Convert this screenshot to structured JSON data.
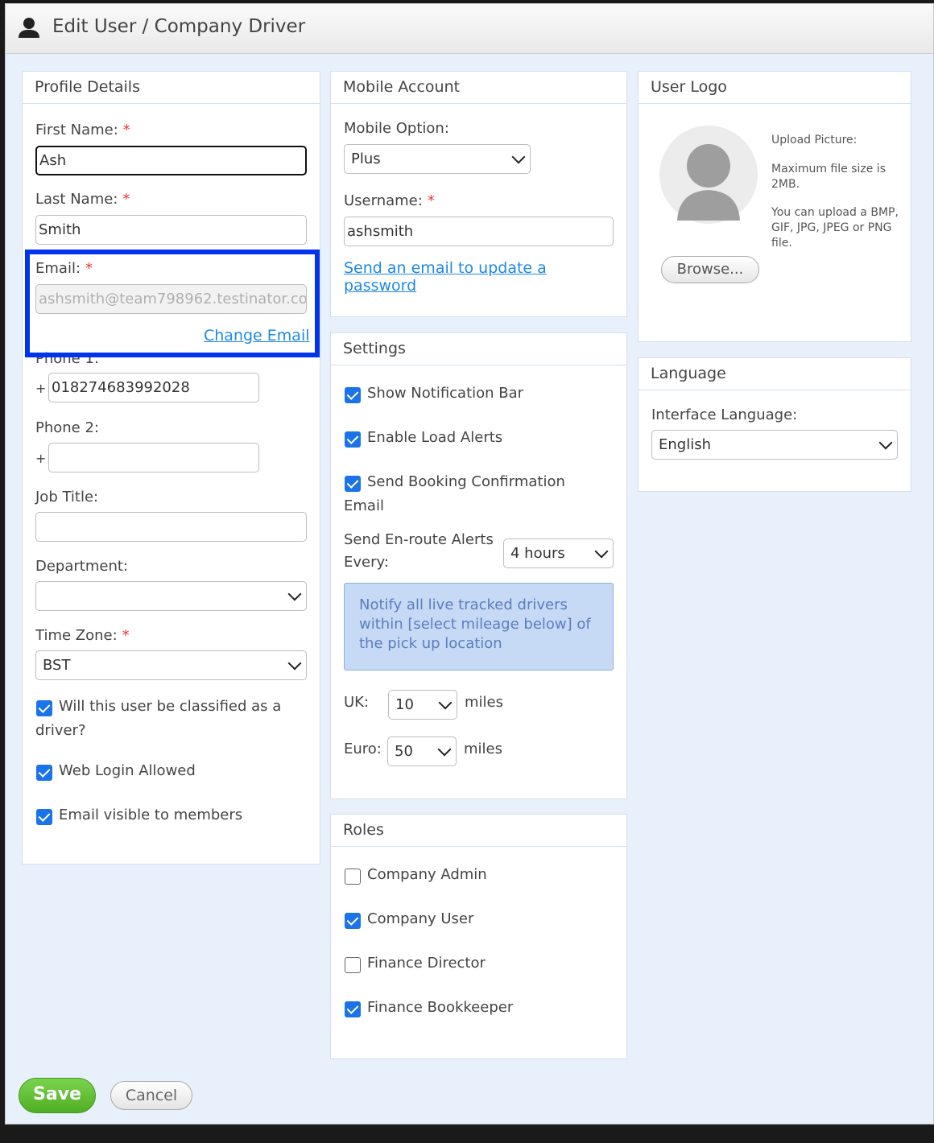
{
  "dialog": {
    "title": "Edit User / Company Driver"
  },
  "profile": {
    "heading": "Profile Details",
    "first_name_label": "First Name:",
    "first_name_value": "Ash",
    "last_name_label": "Last Name:",
    "last_name_value": "Smith",
    "email_label": "Email:",
    "email_value": "ashsmith@team798962.testinator.co",
    "change_email": "Change Email",
    "phone1_label": "Phone 1:",
    "phone1_prefix": "+",
    "phone1_value": "018274683992028",
    "phone2_label": "Phone 2:",
    "phone2_prefix": "+",
    "phone2_value": "",
    "job_title_label": "Job Title:",
    "job_title_value": "",
    "department_label": "Department:",
    "department_value": "",
    "timezone_label": "Time Zone:",
    "timezone_value": "BST",
    "required_marker": "*",
    "driver_line1": "Will this user be classified as a",
    "driver_line2": "driver?",
    "web_login": "Web Login Allowed",
    "email_visible": "Email visible to members"
  },
  "mobile": {
    "heading": "Mobile Account",
    "option_label": "Mobile Option:",
    "option_value": "Plus",
    "username_label": "Username:",
    "username_value": "ashsmith",
    "reset_line1": "Send an email to update a",
    "reset_line2": "password"
  },
  "settings": {
    "heading": "Settings",
    "show_notification": "Show Notification Bar",
    "enable_load_alerts": "Enable Load Alerts",
    "booking_line1": "Send Booking Confirmation",
    "booking_line2": "Email",
    "enroute_line1": "Send En-route Alerts",
    "enroute_line2": "Every:",
    "enroute_value": "4 hours",
    "info_text": "Notify all live tracked drivers within [select mileage below] of the pick up location",
    "uk_label": "UK:",
    "uk_value": "10",
    "euro_label": "Euro:",
    "euro_value": "50",
    "miles": "miles"
  },
  "roles": {
    "heading": "Roles",
    "items": [
      {
        "label": "Company Admin",
        "checked": false
      },
      {
        "label": "Company User",
        "checked": true
      },
      {
        "label": "Finance Director",
        "checked": false
      },
      {
        "label": "Finance Bookkeeper",
        "checked": true
      }
    ]
  },
  "logo": {
    "heading": "User Logo",
    "upload_label": "Upload Picture:",
    "max_size": "Maximum file size is 2MB.",
    "formats": "You can upload a BMP, GIF, JPG, JPEG or PNG file.",
    "browse": "Browse..."
  },
  "language": {
    "heading": "Language",
    "interface_label": "Interface Language:",
    "interface_value": "English"
  },
  "actions": {
    "save": "Save",
    "cancel": "Cancel"
  },
  "colors": {
    "accent": "#1a73e8",
    "save": "#5cbf2a",
    "highlight": "#0033ee",
    "required": "#e53935"
  }
}
